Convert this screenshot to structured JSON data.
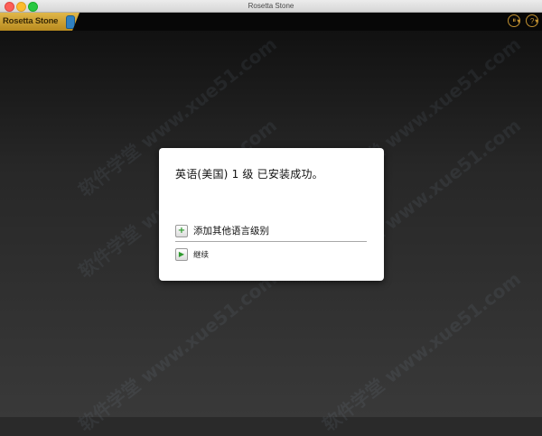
{
  "window": {
    "title": "Rosetta Stone"
  },
  "appbar": {
    "logo_text": "Rosetta Stone",
    "icons": [
      "options-icon",
      "help-icon"
    ],
    "options_glyph": "⏸",
    "help_glyph": "?"
  },
  "dialog": {
    "message": "英语(美国) 1 级 已安装成功。",
    "add_label": "添加其他语言级别",
    "continue_label": "继续"
  },
  "watermark": "软件学堂 www.xue51.com",
  "colors": {
    "brand_gold": "#c09030",
    "dialog_bg": "#ffffff",
    "accent_green": "#2e9a2e"
  }
}
